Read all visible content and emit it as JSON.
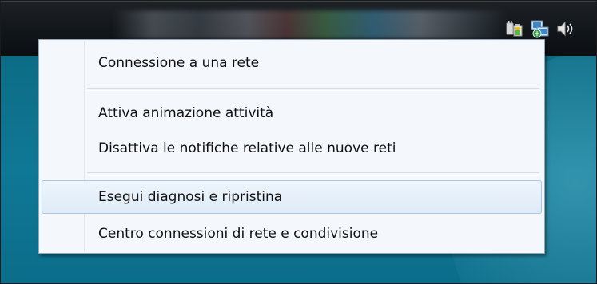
{
  "tray": {
    "icons": [
      "power-plug-icon",
      "network-icon",
      "volume-icon"
    ]
  },
  "menu": {
    "items": [
      {
        "label": "Connessione a una rete"
      },
      {
        "label": "Attiva animazione attività"
      },
      {
        "label": "Disattiva le notifiche relative alle nuove reti"
      },
      {
        "label": "Esegui diagnosi e ripristina"
      },
      {
        "label": "Centro connessioni di rete e condivisione"
      }
    ],
    "highlighted_item": "Esegui diagnosi e ripristina"
  },
  "colors": {
    "desktop": "#0f7896",
    "taskbar": "#11161a",
    "menu_background": "#f4f7fb",
    "highlight": "#dfebf7"
  }
}
